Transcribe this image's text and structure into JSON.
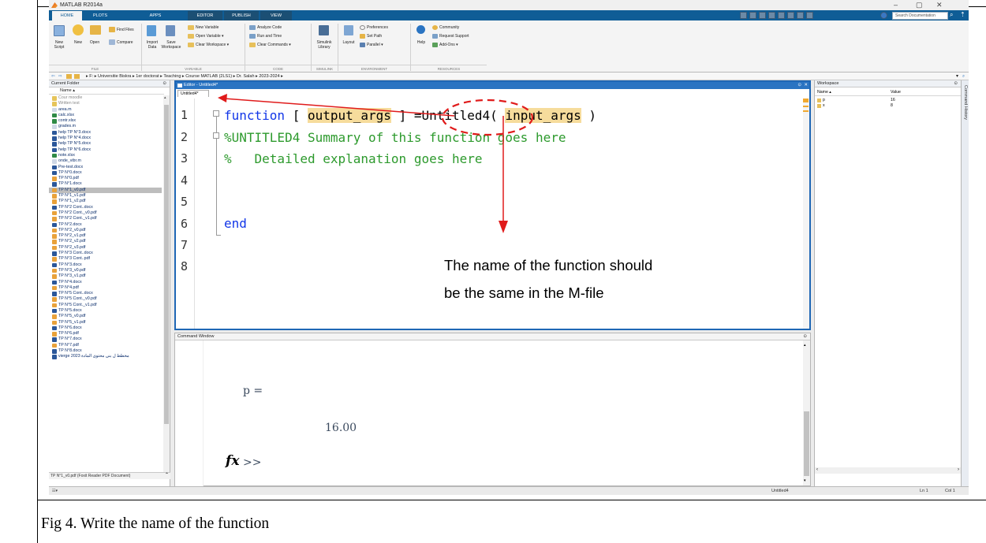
{
  "app": {
    "title": "MATLAB R2014a",
    "search_placeholder": "Search Documentation"
  },
  "tabs": [
    "HOME",
    "PLOTS",
    "APPS",
    "EDITOR",
    "PUBLISH",
    "VIEW"
  ],
  "ribbon": {
    "new_script": "New\nScript",
    "new": "New",
    "open": "Open",
    "find_files": "Find Files",
    "compare": "Compare",
    "import_data": "Import\nData",
    "save_workspace": "Save\nWorkspace",
    "new_variable": "New Variable",
    "open_variable": "Open Variable ▾",
    "clear_workspace": "Clear Workspace ▾",
    "analyze_code": "Analyze Code",
    "run_and_time": "Run and Time",
    "clear_commands": "Clear Commands ▾",
    "simulink_library": "Simulink\nLibrary",
    "layout": "Layout",
    "preferences": "Preferences",
    "set_path": "Set Path",
    "parallel": "Parallel ▾",
    "help": "Help",
    "community": "Community",
    "request_support": "Request Support",
    "add_ons": "Add-Ons ▾",
    "sections": [
      "FILE",
      "VARIABLE",
      "CODE",
      "SIMULINK",
      "ENVIRONMENT",
      "RESOURCES"
    ]
  },
  "address": {
    "path": "▸ F: ▸ Universitie Biskra ▸ 1er doctorat ▸ Teaching ▸ Course MATLAB (2LS1) ▸ Dr. Salah ▸ 2023-2024 ▸"
  },
  "current_folder": {
    "title": "Current Folder",
    "column": "Name ▴",
    "files": [
      {
        "name": "Cour moodle",
        "type": "folder"
      },
      {
        "name": "Written test",
        "type": "folder"
      },
      {
        "name": "area.m",
        "type": "m"
      },
      {
        "name": "calc.xlsx",
        "type": "xlsx"
      },
      {
        "name": "contr.xlsx",
        "type": "xlsx"
      },
      {
        "name": "grades.m",
        "type": "m"
      },
      {
        "name": "help TP N°3.docx",
        "type": "docx"
      },
      {
        "name": "help TP N°4.docx",
        "type": "docx"
      },
      {
        "name": "help TP N°5.docx",
        "type": "docx"
      },
      {
        "name": "help TP N°6.docx",
        "type": "docx"
      },
      {
        "name": "note.xlsx",
        "type": "xlsx"
      },
      {
        "name": "onde_vibr.m",
        "type": "m"
      },
      {
        "name": "Pre-test.docx",
        "type": "docx"
      },
      {
        "name": "TP N°0.docx",
        "type": "docx"
      },
      {
        "name": "TP N°0.pdf",
        "type": "pdf"
      },
      {
        "name": "TP N°1.docx",
        "type": "docx"
      },
      {
        "name": "TP N°1_v0.pdf",
        "type": "pdf"
      },
      {
        "name": "TP N°1_v1.pdf",
        "type": "pdf"
      },
      {
        "name": "TP N°1_v2.pdf",
        "type": "pdf"
      },
      {
        "name": "TP N°2 Cont..docx",
        "type": "docx"
      },
      {
        "name": "TP N°2 Cont._v0.pdf",
        "type": "pdf"
      },
      {
        "name": "TP N°2 Cont._v1.pdf",
        "type": "pdf"
      },
      {
        "name": "TP N°2.docx",
        "type": "docx"
      },
      {
        "name": "TP N°2_v0.pdf",
        "type": "pdf"
      },
      {
        "name": "TP N°2_v1.pdf",
        "type": "pdf"
      },
      {
        "name": "TP N°2_v2.pdf",
        "type": "pdf"
      },
      {
        "name": "TP N°2_v3.pdf",
        "type": "pdf"
      },
      {
        "name": "TP N°3 Cont..docx",
        "type": "docx"
      },
      {
        "name": "TP N°3 Cont..pdf",
        "type": "pdf"
      },
      {
        "name": "TP N°3.docx",
        "type": "docx"
      },
      {
        "name": "TP N°3_v0.pdf",
        "type": "pdf"
      },
      {
        "name": "TP N°3_v1.pdf",
        "type": "pdf"
      },
      {
        "name": "TP N°4.docx",
        "type": "docx"
      },
      {
        "name": "TP N°4.pdf",
        "type": "pdf"
      },
      {
        "name": "TP N°5 Cont..docx",
        "type": "docx"
      },
      {
        "name": "TP N°5 Cont._v0.pdf",
        "type": "pdf"
      },
      {
        "name": "TP N°5 Cont._v1.pdf",
        "type": "pdf"
      },
      {
        "name": "TP N°5.docx",
        "type": "docx"
      },
      {
        "name": "TP N°5_v0.pdf",
        "type": "pdf"
      },
      {
        "name": "TP N°5_v1.pdf",
        "type": "pdf"
      },
      {
        "name": "TP N°6.docx",
        "type": "docx"
      },
      {
        "name": "TP N°6.pdf",
        "type": "pdf"
      },
      {
        "name": "TP N°7.docx",
        "type": "docx"
      },
      {
        "name": "TP N°7.pdf",
        "type": "pdf"
      },
      {
        "name": "TP N°8.docx",
        "type": "docx"
      },
      {
        "name": "vierge 2023 مخطط ل بنى محتوى المادة",
        "type": "docx"
      }
    ],
    "selected_index": 16,
    "details": "TP N°1_v0.pdf (Foxit Reader PDF Document)"
  },
  "editor": {
    "title": "Editor - Untitled4*",
    "tab": "Untitled4*",
    "line_numbers": [
      "1",
      "2",
      "3",
      "4",
      "5",
      "6",
      "7",
      "8"
    ],
    "line1": {
      "kw": "function",
      "b1": " [ ",
      "out": "output_args",
      "b2": " ] =",
      "name": "Untitled4",
      "p1": "( ",
      "inp": "input_args",
      "p2": " )"
    },
    "line2": "%UNTITLED4 Summary of this function goes here",
    "line3": "%   Detailed explanation goes here",
    "line6": "end"
  },
  "annotation": {
    "line1": "The name of the function should",
    "line2": "be the same in the M-file"
  },
  "command_window": {
    "title": "Command Window",
    "var": "p =",
    "value": "16.00",
    "prompt": ">>"
  },
  "workspace": {
    "title": "Workspace",
    "col_name": "Name ▴",
    "col_value": "Value",
    "vars": [
      {
        "name": "p",
        "value": "16"
      },
      {
        "name": "x",
        "value": "8"
      }
    ]
  },
  "command_history": {
    "title": "Command History"
  },
  "status": {
    "file": "Untitled4",
    "ln": "Ln  1",
    "col": "Col  1"
  },
  "caption": "Fig 4. Write the name of the function",
  "colors": {
    "matlab_blue": "#0f5d96",
    "editor_border": "#1f67b5",
    "annotation_red": "#e01b1b",
    "highlight": "#f6dc9c"
  }
}
